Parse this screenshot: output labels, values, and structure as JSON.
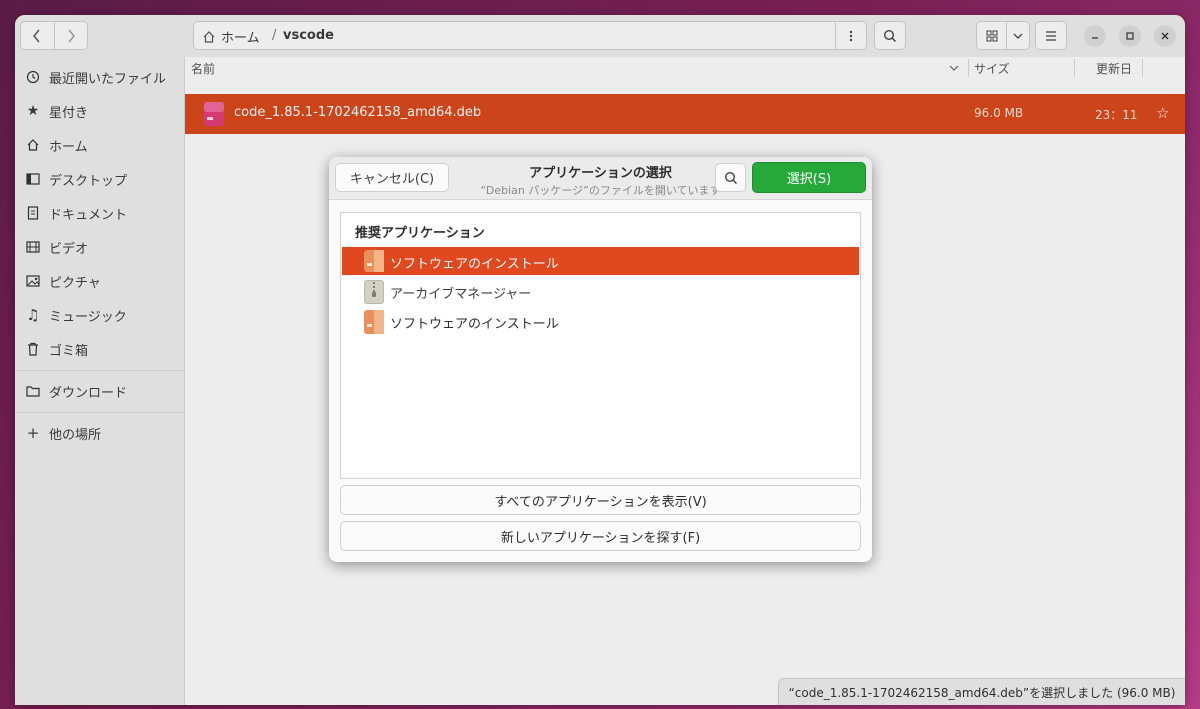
{
  "window": {
    "path": {
      "home": "ホーム",
      "separator": "/",
      "current": "vscode"
    }
  },
  "sidebar": {
    "items": [
      {
        "label": "最近開いたファイル",
        "icon": "clock-icon"
      },
      {
        "label": "星付き",
        "icon": "star-icon"
      },
      {
        "label": "ホーム",
        "icon": "home-icon"
      },
      {
        "label": "デスクトップ",
        "icon": "desktop-icon"
      },
      {
        "label": "ドキュメント",
        "icon": "document-icon"
      },
      {
        "label": "ビデオ",
        "icon": "video-icon"
      },
      {
        "label": "ピクチャ",
        "icon": "picture-icon"
      },
      {
        "label": "ミュージック",
        "icon": "music-icon"
      },
      {
        "label": "ゴミ箱",
        "icon": "trash-icon"
      },
      {
        "label": "ダウンロード",
        "icon": "folder-icon"
      },
      {
        "label": "他の場所",
        "icon": "plus-icon"
      }
    ]
  },
  "file_list": {
    "columns": {
      "name": "名前",
      "size": "サイズ",
      "modified": "更新日"
    },
    "files": [
      {
        "name": "code_1.85.1-1702462158_amd64.deb",
        "size": "96.0 MB",
        "modified": "23：11",
        "star": "☆"
      }
    ]
  },
  "status": "“code_1.85.1-1702462158_amd64.deb”を選択しました (96.0 MB)",
  "dialog": {
    "cancel_label": "キャンセル(C)",
    "title": "アプリケーションの選択",
    "subtitle": "“Debian パッケージ”のファイルを開いています",
    "select_label": "選択(S)",
    "list_heading": "推奨アプリケーション",
    "apps": [
      {
        "label": "ソフトウェアのインストール",
        "selected": true,
        "icon": "software-install-icon"
      },
      {
        "label": "アーカイブマネージャー",
        "selected": false,
        "icon": "archive-manager-icon"
      },
      {
        "label": "ソフトウェアのインストール",
        "selected": false,
        "icon": "software-install-icon"
      }
    ],
    "show_all_label": "すべてのアプリケーションを表示(V)",
    "find_new_label": "新しいアプリケーションを探す(F)"
  },
  "colors": {
    "selection": "#e0481f",
    "accent_green": "#26a93a",
    "desktop_bg": "#7a1f55"
  }
}
